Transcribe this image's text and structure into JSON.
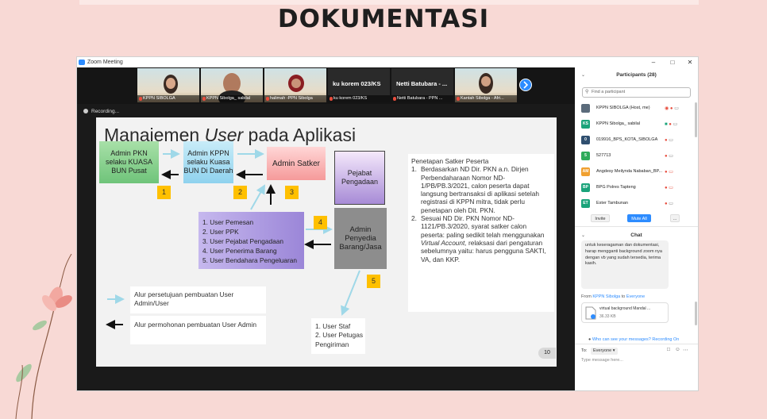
{
  "page_title": "DOKUMENTASI",
  "window": {
    "title": "Zoom Meeting",
    "controls": [
      "–",
      "□",
      "✕"
    ]
  },
  "thumbnails": [
    {
      "name": "KPPN SIBOLGA",
      "has_video": true
    },
    {
      "name": "KPPN Sibolga_ sabilal",
      "has_video": true
    },
    {
      "name": "halimah -PPN Sibolga",
      "has_video": true
    },
    {
      "name": "ku korem 023/KS",
      "big_label": "ku korem 023/KS",
      "has_video": false
    },
    {
      "name": "Netti Batubara - PPN ...",
      "big_label": "Netti Batubara - ...",
      "has_video": false
    },
    {
      "name": "Kantah Sibolga - Afri...",
      "has_video": true
    }
  ],
  "recording_label": "Recording...",
  "slide": {
    "title_pre": "Manajemen ",
    "title_em": "User",
    "title_post": " pada Aplikasi",
    "boxes": {
      "admin_pkn": "Admin PKN selaku KUASA BUN Pusat",
      "admin_kppn": "Admin KPPN selaku Kuasa BUN Di Daerah",
      "admin_satker": "Admin Satker",
      "pejabat": "Pejabat Pengadaan",
      "admin_penyedia": "Admin Penyedia Barang/Jasa"
    },
    "numbers": [
      "1",
      "2",
      "3",
      "4",
      "5"
    ],
    "user_list": [
      "1. User Pemesan",
      "2. User PPK",
      "3. User Pejabat Pengadaan",
      "4. User Penerima Barang",
      "5. User Bendahara Pengeluaran"
    ],
    "staff_list": [
      "1. User Staf",
      "2. User Petugas Pengiriman"
    ],
    "legend": {
      "approval": "Alur persetujuan pembuatan User Admin/User",
      "request": "Alur permohonan pembuatan User Admin"
    },
    "penetapan": {
      "heading": "Penetapan Satker Peserta",
      "item1": "Berdasarkan ND Dir. PKN a.n. Dirjen Perbendaharaan Nomor ND-1/PB/PB.3/2021, calon peserta dapat langsung bertransaksi di aplikasi setelah registrasi di KPPN mitra, tidak perlu penetapan oleh Dit. PKN.",
      "item2_pre": "Sesuai ND Dir. PKN Nomor ND-1121/PB.3/2020, syarat satker calon peserta: paling sedikit telah menggunakan ",
      "item2_em": "Virtual Account,",
      "item2_post": " relaksasi dari pengaturan sebelumnya yaitu: harus pengguna SAKTI, VA, dan KKP."
    },
    "page_number": "10"
  },
  "participants": {
    "header": "Participants (28)",
    "search_placeholder": "Find a participant",
    "list": [
      {
        "initials": "",
        "name": "KPPN SIBOLGA (Host, me)",
        "color": "#5b6b7b"
      },
      {
        "initials": "KS",
        "name": "KPPN Sibolga_ sabilal",
        "color": "#1aa37a"
      },
      {
        "initials": "0",
        "name": "019916_BPS_KOTA_SIBOLGA",
        "color": "#2f4f6f"
      },
      {
        "initials": "5",
        "name": "527713",
        "color": "#2eaa5a"
      },
      {
        "initials": "AM",
        "name": "Angdesy Meilynda Nababan_BP...",
        "color": "#f0a030"
      },
      {
        "initials": "BP",
        "name": "BPG Polres Tapteng",
        "color": "#1aa37a"
      },
      {
        "initials": "ET",
        "name": "Ester Tambunan",
        "color": "#1aa37a"
      }
    ],
    "invite": "Invite",
    "mute_all": "Mute All",
    "more": "..."
  },
  "chat": {
    "header": "Chat",
    "message": "untuk keseragaman dan dokumentasi, harap mengganti background zoom nya dengan vb yang sudah tersedia, terima kasih.",
    "from_prefix": "From ",
    "from_name": "KPPN Sibolga",
    "from_mid": "  to ",
    "to_name": "Everyone",
    "file_name": "virtual background Mandal ...",
    "file_size": "36.33 KB",
    "notice": "Who can see your messages? Recording On",
    "to_label": "To:",
    "recipient": "Everyone",
    "input_placeholder": "Type message here..."
  },
  "colors": {
    "zoom_blue": "#2d8cff",
    "slide_bg": "#f2f2f2",
    "badge_yellow": "#ffc000",
    "page_bg": "#f8d9d5"
  }
}
